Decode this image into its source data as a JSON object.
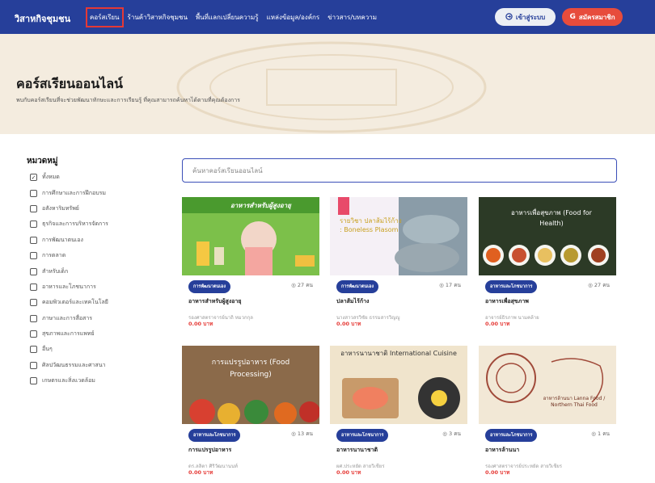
{
  "header": {
    "brand": "วิสาหกิจชุมชน",
    "nav": [
      "คอร์สเรียน",
      "ร้านค้าวิสาหกิจชุมชน",
      "พื้นที่แลกเปลี่ยนความรู้",
      "แหล่งข้อมูล/องค์กร",
      "ข่าวสาร/บทความ"
    ],
    "login_label": "เข้าสู่ระบบ",
    "register_label": "สมัครสมาชิก",
    "accent_color": "#263f9a",
    "register_color": "#e74c3c"
  },
  "hero": {
    "title": "คอร์สเรียนออนไลน์",
    "subtitle": "พบกับคอร์สเรียนที่จะช่วยพัฒนาทักษะและการเรียนรู้ ที่คุณสามารถค้นหาได้ตามที่คุณต้องการ"
  },
  "sidebar": {
    "title": "หมวดหมู่",
    "categories": [
      {
        "label": "ทั้งหมด",
        "checked": true
      },
      {
        "label": "การศึกษาและการฝึกอบรม",
        "checked": false
      },
      {
        "label": "อสังหาริมทรัพย์",
        "checked": false
      },
      {
        "label": "ธุรกิจและการบริหารจัดการ",
        "checked": false
      },
      {
        "label": "การพัฒนาตนเอง",
        "checked": false
      },
      {
        "label": "การตลาด",
        "checked": false
      },
      {
        "label": "สำหรับเด็ก",
        "checked": false
      },
      {
        "label": "อาหารและโภชนาการ",
        "checked": false
      },
      {
        "label": "คอมพิวเตอร์และเทคโนโลยี",
        "checked": false
      },
      {
        "label": "ภาษาและการสื่อสาร",
        "checked": false
      },
      {
        "label": "สุขภาพและการแพทย์",
        "checked": false
      },
      {
        "label": "อื่นๆ",
        "checked": false
      },
      {
        "label": "ศิลปวัฒนธรรมและศาสนา",
        "checked": false
      },
      {
        "label": "เกษตรและสิ่งแวดล้อม",
        "checked": false
      }
    ]
  },
  "search": {
    "placeholder": "ค้นหาคอร์สเรียนออนไลน์"
  },
  "courses": [
    {
      "badge": "การพัฒนาตนเอง",
      "views": "27 คน",
      "title": "อาหารสำหรับผู้สูงอายุ",
      "author": "รองศาสตราจารย์นาถิ หมวกกุล",
      "price": "0.00 บาท",
      "image_text": "อาหารสำหรับผู้สูงอายุ"
    },
    {
      "badge": "การพัฒนาตนเอง",
      "views": "17 คน",
      "title": "ปลาส้มไร้ก้าง",
      "author": "นางสาวสรวิชัย ธรรมสารวิญญู",
      "price": "0.00 บาท",
      "image_text": "รายวิชา ปลาส้มไร้ก้าง : Boneless Plasom"
    },
    {
      "badge": "อาหารและโภชนาการ",
      "views": "27 คน",
      "title": "อาหารเพื่อสุขภาพ",
      "author": "อาจารย์ธิรภาพ นามคล้าย",
      "price": "0.00 บาท",
      "image_text": "อาหารเพื่อสุขภาพ (Food for Health)"
    },
    {
      "badge": "อาหารและโภชนาการ",
      "views": "13 คน",
      "title": "การแปรรูปอาหาร",
      "author": "ดร.ลลิตา ศิริวัฒนานนท์",
      "price": "0.00 บาท",
      "image_text": "การแปรรูปอาหาร (Food Processing)"
    },
    {
      "badge": "อาหารและโภชนาการ",
      "views": "3 คน",
      "title": "อาหารนานาชาติ",
      "author": "ผศ.ประหยัด สายวิเชียร",
      "price": "0.00 บาท",
      "image_text": "อาหารนานาชาติ International Cuisine"
    },
    {
      "badge": "อาหารและโภชนาการ",
      "views": "1 คน",
      "title": "อาหารล้านนา",
      "author": "รองศาสตราจารย์ประหยัด สายวิเชียร",
      "price": "0.00 บาท",
      "image_text": "อาหารล้านนา Lanna Food / Northern Thai Food"
    }
  ]
}
